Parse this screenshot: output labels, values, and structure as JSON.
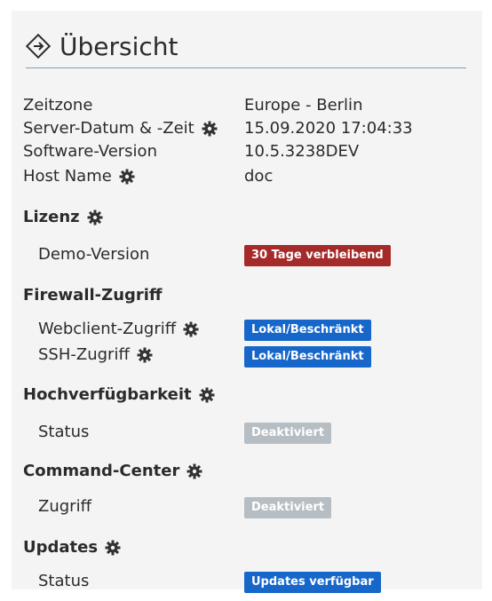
{
  "header": {
    "title": "Übersicht",
    "icon": "diamond-icon"
  },
  "info": {
    "timezone_label": "Zeitzone",
    "timezone_value": "Europe - Berlin",
    "server_datetime_label": "Server-Datum & -Zeit",
    "server_datetime_value": "15.09.2020 17:04:33",
    "software_version_label": "Software-Version",
    "software_version_value": "10.5.3238DEV",
    "host_name_label": "Host Name",
    "host_name_value": "doc"
  },
  "license": {
    "section_label": "Lizenz",
    "item_label": "Demo-Version",
    "badge": "30 Tage verbleibend",
    "badge_color": "#a52a2a"
  },
  "firewall": {
    "section_label": "Firewall-Zugriff",
    "webclient_label": "Webclient-Zugriff",
    "webclient_badge": "Lokal/Beschränkt",
    "ssh_label": "SSH-Zugriff",
    "ssh_badge": "Lokal/Beschränkt",
    "badge_color": "#1766c9"
  },
  "high_availability": {
    "section_label": "Hochverfügbarkeit",
    "status_label": "Status",
    "status_badge": "Deaktiviert",
    "badge_color": "#b6bdc3"
  },
  "command_center": {
    "section_label": "Command-Center",
    "access_label": "Zugriff",
    "access_badge": "Deaktiviert",
    "badge_color": "#b6bdc3"
  },
  "updates": {
    "section_label": "Updates",
    "status_label": "Status",
    "status_badge": "Updates verfügbar",
    "badge_color": "#1766c9"
  }
}
